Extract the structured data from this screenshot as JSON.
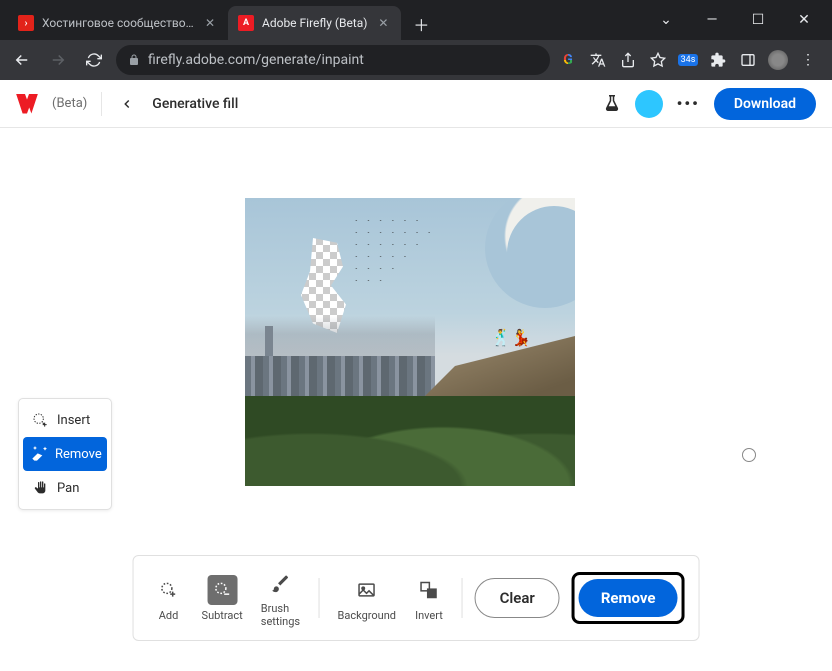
{
  "browser": {
    "tabs": [
      {
        "title": "Хостинговое сообщество «Time",
        "active": false
      },
      {
        "title": "Adobe Firefly (Beta)",
        "active": true
      }
    ],
    "url": "firefly.adobe.com/generate/inpaint",
    "ext_badge": "34s"
  },
  "header": {
    "beta": "(Beta)",
    "breadcrumb": "Generative fill",
    "download": "Download"
  },
  "tools": {
    "insert": "Insert",
    "remove": "Remove",
    "pan": "Pan"
  },
  "bottom": {
    "add": "Add",
    "subtract": "Subtract",
    "brush": "Brush settings",
    "background": "Background",
    "invert": "Invert",
    "clear": "Clear",
    "remove": "Remove"
  }
}
